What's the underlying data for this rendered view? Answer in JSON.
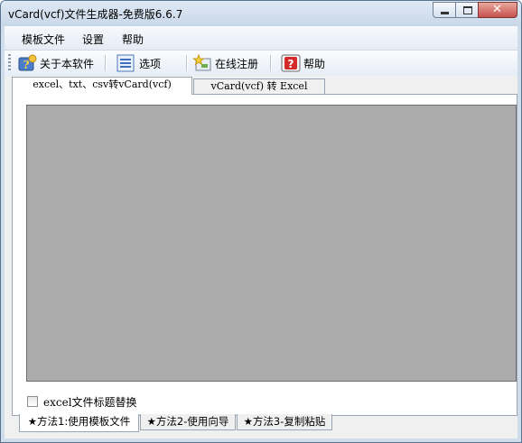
{
  "window": {
    "title": "vCard(vcf)文件生成器-免费版6.6.7"
  },
  "menu": {
    "items": [
      "模板文件",
      "设置",
      "帮助"
    ]
  },
  "toolbar": {
    "about_label": "关于本软件",
    "options_label": "选项",
    "register_label": "在线注册",
    "help_label": "帮助"
  },
  "top_tabs": [
    "excel、txt、csv转vCard(vcf)",
    "vCard(vcf) 转 Excel"
  ],
  "panel": {
    "replace_header_label": "excel文件标题替换",
    "replace_header_checked": false
  },
  "bottom_tabs": [
    "★方法1:使用模板文件",
    "★方法2-使用向导",
    "★方法3-复制粘贴"
  ],
  "colors": {
    "content_gray": "#ababab",
    "close_red": "#c75050"
  }
}
